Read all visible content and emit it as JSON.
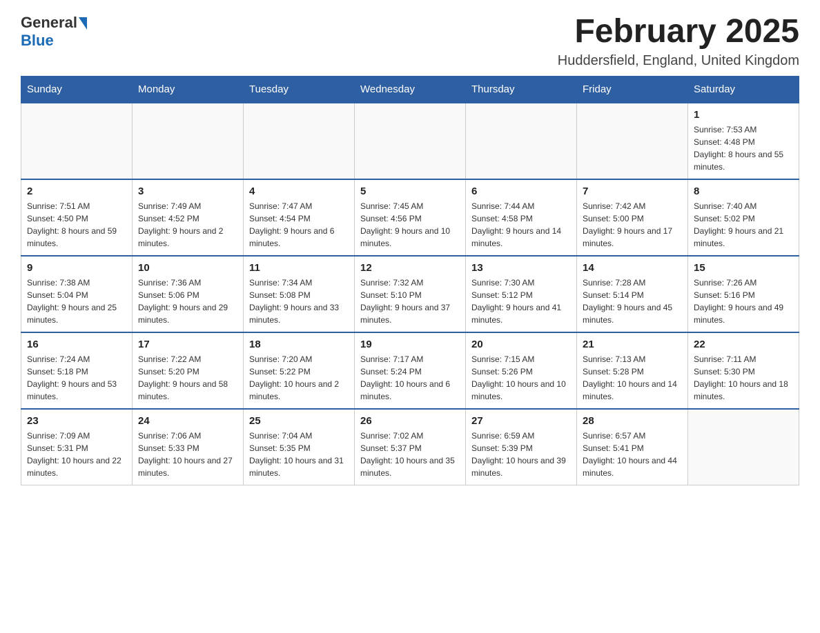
{
  "header": {
    "logo_general": "General",
    "logo_blue": "Blue",
    "month_title": "February 2025",
    "location": "Huddersfield, England, United Kingdom"
  },
  "days_of_week": [
    "Sunday",
    "Monday",
    "Tuesday",
    "Wednesday",
    "Thursday",
    "Friday",
    "Saturday"
  ],
  "weeks": [
    [
      {
        "day": "",
        "info": ""
      },
      {
        "day": "",
        "info": ""
      },
      {
        "day": "",
        "info": ""
      },
      {
        "day": "",
        "info": ""
      },
      {
        "day": "",
        "info": ""
      },
      {
        "day": "",
        "info": ""
      },
      {
        "day": "1",
        "info": "Sunrise: 7:53 AM\nSunset: 4:48 PM\nDaylight: 8 hours and 55 minutes."
      }
    ],
    [
      {
        "day": "2",
        "info": "Sunrise: 7:51 AM\nSunset: 4:50 PM\nDaylight: 8 hours and 59 minutes."
      },
      {
        "day": "3",
        "info": "Sunrise: 7:49 AM\nSunset: 4:52 PM\nDaylight: 9 hours and 2 minutes."
      },
      {
        "day": "4",
        "info": "Sunrise: 7:47 AM\nSunset: 4:54 PM\nDaylight: 9 hours and 6 minutes."
      },
      {
        "day": "5",
        "info": "Sunrise: 7:45 AM\nSunset: 4:56 PM\nDaylight: 9 hours and 10 minutes."
      },
      {
        "day": "6",
        "info": "Sunrise: 7:44 AM\nSunset: 4:58 PM\nDaylight: 9 hours and 14 minutes."
      },
      {
        "day": "7",
        "info": "Sunrise: 7:42 AM\nSunset: 5:00 PM\nDaylight: 9 hours and 17 minutes."
      },
      {
        "day": "8",
        "info": "Sunrise: 7:40 AM\nSunset: 5:02 PM\nDaylight: 9 hours and 21 minutes."
      }
    ],
    [
      {
        "day": "9",
        "info": "Sunrise: 7:38 AM\nSunset: 5:04 PM\nDaylight: 9 hours and 25 minutes."
      },
      {
        "day": "10",
        "info": "Sunrise: 7:36 AM\nSunset: 5:06 PM\nDaylight: 9 hours and 29 minutes."
      },
      {
        "day": "11",
        "info": "Sunrise: 7:34 AM\nSunset: 5:08 PM\nDaylight: 9 hours and 33 minutes."
      },
      {
        "day": "12",
        "info": "Sunrise: 7:32 AM\nSunset: 5:10 PM\nDaylight: 9 hours and 37 minutes."
      },
      {
        "day": "13",
        "info": "Sunrise: 7:30 AM\nSunset: 5:12 PM\nDaylight: 9 hours and 41 minutes."
      },
      {
        "day": "14",
        "info": "Sunrise: 7:28 AM\nSunset: 5:14 PM\nDaylight: 9 hours and 45 minutes."
      },
      {
        "day": "15",
        "info": "Sunrise: 7:26 AM\nSunset: 5:16 PM\nDaylight: 9 hours and 49 minutes."
      }
    ],
    [
      {
        "day": "16",
        "info": "Sunrise: 7:24 AM\nSunset: 5:18 PM\nDaylight: 9 hours and 53 minutes."
      },
      {
        "day": "17",
        "info": "Sunrise: 7:22 AM\nSunset: 5:20 PM\nDaylight: 9 hours and 58 minutes."
      },
      {
        "day": "18",
        "info": "Sunrise: 7:20 AM\nSunset: 5:22 PM\nDaylight: 10 hours and 2 minutes."
      },
      {
        "day": "19",
        "info": "Sunrise: 7:17 AM\nSunset: 5:24 PM\nDaylight: 10 hours and 6 minutes."
      },
      {
        "day": "20",
        "info": "Sunrise: 7:15 AM\nSunset: 5:26 PM\nDaylight: 10 hours and 10 minutes."
      },
      {
        "day": "21",
        "info": "Sunrise: 7:13 AM\nSunset: 5:28 PM\nDaylight: 10 hours and 14 minutes."
      },
      {
        "day": "22",
        "info": "Sunrise: 7:11 AM\nSunset: 5:30 PM\nDaylight: 10 hours and 18 minutes."
      }
    ],
    [
      {
        "day": "23",
        "info": "Sunrise: 7:09 AM\nSunset: 5:31 PM\nDaylight: 10 hours and 22 minutes."
      },
      {
        "day": "24",
        "info": "Sunrise: 7:06 AM\nSunset: 5:33 PM\nDaylight: 10 hours and 27 minutes."
      },
      {
        "day": "25",
        "info": "Sunrise: 7:04 AM\nSunset: 5:35 PM\nDaylight: 10 hours and 31 minutes."
      },
      {
        "day": "26",
        "info": "Sunrise: 7:02 AM\nSunset: 5:37 PM\nDaylight: 10 hours and 35 minutes."
      },
      {
        "day": "27",
        "info": "Sunrise: 6:59 AM\nSunset: 5:39 PM\nDaylight: 10 hours and 39 minutes."
      },
      {
        "day": "28",
        "info": "Sunrise: 6:57 AM\nSunset: 5:41 PM\nDaylight: 10 hours and 44 minutes."
      },
      {
        "day": "",
        "info": ""
      }
    ]
  ]
}
